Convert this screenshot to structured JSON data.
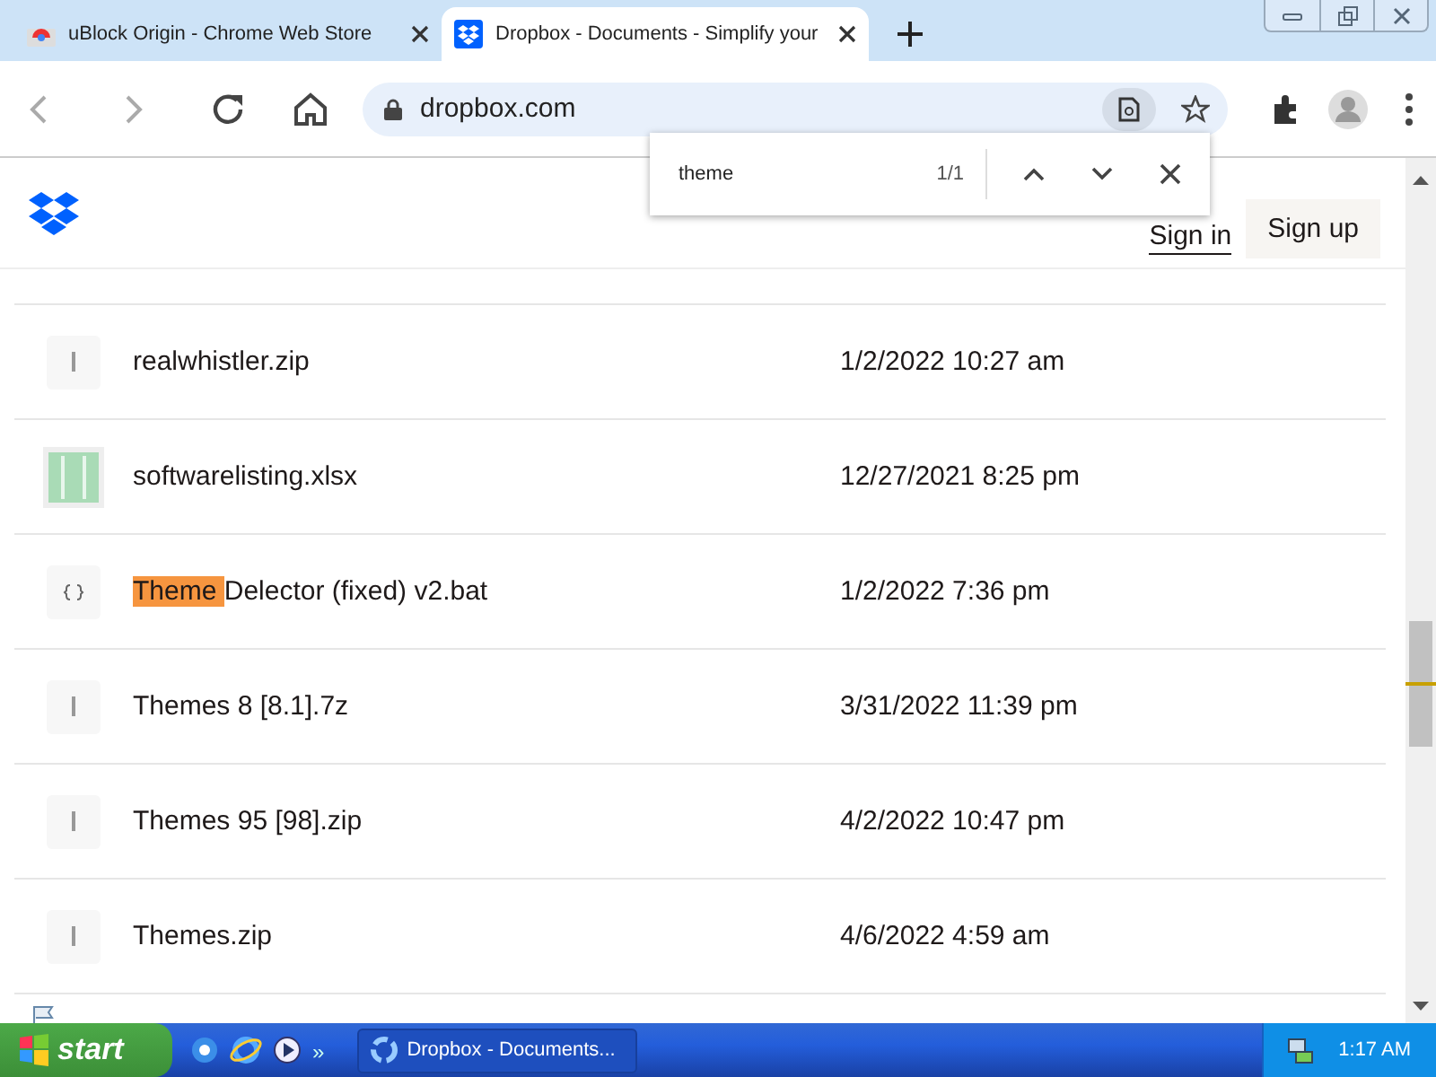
{
  "browser_tabs": [
    {
      "title": "uBlock Origin - Chrome Web Store",
      "selected": false
    },
    {
      "title": "Dropbox - Documents - Simplify your",
      "selected": true
    }
  ],
  "address_bar": {
    "url": "dropbox.com"
  },
  "find_bar": {
    "query": "theme",
    "count": "1/1"
  },
  "header": {
    "sign_in": "Sign in",
    "sign_up": "Sign up"
  },
  "files": [
    {
      "kind": "zip",
      "parts": [
        {
          "text": "realwhistler.zip",
          "highlighted": false
        }
      ],
      "date": "1/2/2022 10:27 am"
    },
    {
      "kind": "sheet",
      "parts": [
        {
          "text": "softwarelisting.xlsx",
          "highlighted": false
        }
      ],
      "date": "12/27/2021 8:25 pm"
    },
    {
      "kind": "code",
      "parts": [
        {
          "text": "Theme ",
          "highlighted": true
        },
        {
          "text": "Delector (fixed) v2.bat",
          "highlighted": false
        }
      ],
      "date": "1/2/2022 7:36 pm"
    },
    {
      "kind": "zip",
      "parts": [
        {
          "text": "Themes 8 [8.1].7z",
          "highlighted": false
        }
      ],
      "date": "3/31/2022 11:39 pm"
    },
    {
      "kind": "zip",
      "parts": [
        {
          "text": "Themes 95 [98].zip",
          "highlighted": false
        }
      ],
      "date": "4/2/2022 10:47 pm"
    },
    {
      "kind": "zip",
      "parts": [
        {
          "text": "Themes.zip",
          "highlighted": false
        }
      ],
      "date": "4/6/2022 4:59 am"
    }
  ],
  "taskbar": {
    "start": "start",
    "chevron": "»",
    "task": "Dropbox - Documents...",
    "clock": "1:17 AM"
  }
}
